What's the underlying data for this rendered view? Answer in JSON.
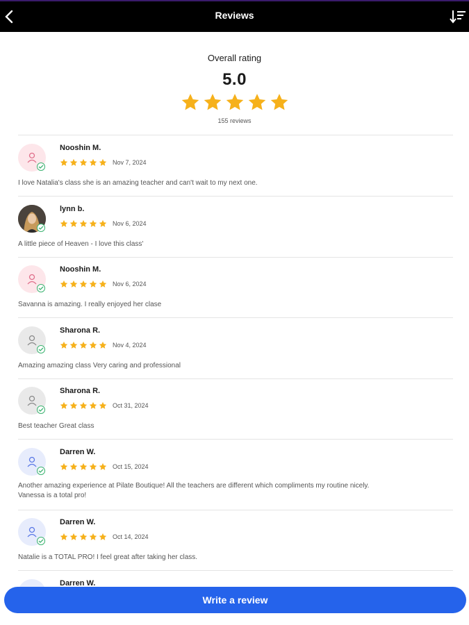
{
  "header": {
    "title": "Reviews",
    "back_icon": "chevron-left-icon",
    "sort_icon": "sort-descending-icon"
  },
  "summary": {
    "label": "Overall rating",
    "score": "5.0",
    "stars": 5,
    "count": "155 reviews"
  },
  "reviews": [
    {
      "name": "Nooshin M.",
      "date": "Nov 7, 2024",
      "rating": 5,
      "text": "I love Natalia's class she is an amazing teacher and can't wait to my next one.",
      "avatar": "pink"
    },
    {
      "name": "lynn b.",
      "date": "Nov 6, 2024",
      "rating": 5,
      "text": "A little piece of Heaven - I love this class'",
      "avatar": "photo"
    },
    {
      "name": "Nooshin M.",
      "date": "Nov 6, 2024",
      "rating": 5,
      "text": "Savanna is amazing. I really enjoyed her clase",
      "avatar": "pink"
    },
    {
      "name": "Sharona R.",
      "date": "Nov 4, 2024",
      "rating": 5,
      "text": "Amazing amazing class Very caring and professional",
      "avatar": "grey"
    },
    {
      "name": "Sharona R.",
      "date": "Oct 31, 2024",
      "rating": 5,
      "text": "Best teacher Great class",
      "avatar": "grey"
    },
    {
      "name": "Darren W.",
      "date": "Oct 15, 2024",
      "rating": 5,
      "text_line1": "Another amazing experience at Pilate Boutique! All the teachers are different which compliments my routine nicely.",
      "text_line2": "Vanessa is a total pro!",
      "avatar": "blue"
    },
    {
      "name": "Darren W.",
      "date": "Oct 14, 2024",
      "rating": 5,
      "text": "Natalie is a TOTAL PRO! I feel great after taking her class.",
      "avatar": "blue"
    },
    {
      "name": "Darren W.",
      "avatar": "blue"
    }
  ],
  "actions": {
    "write_review_label": "Write a review"
  },
  "colors": {
    "star": "#f6b11b",
    "primary": "#2563eb",
    "verified": "#3cb371"
  }
}
